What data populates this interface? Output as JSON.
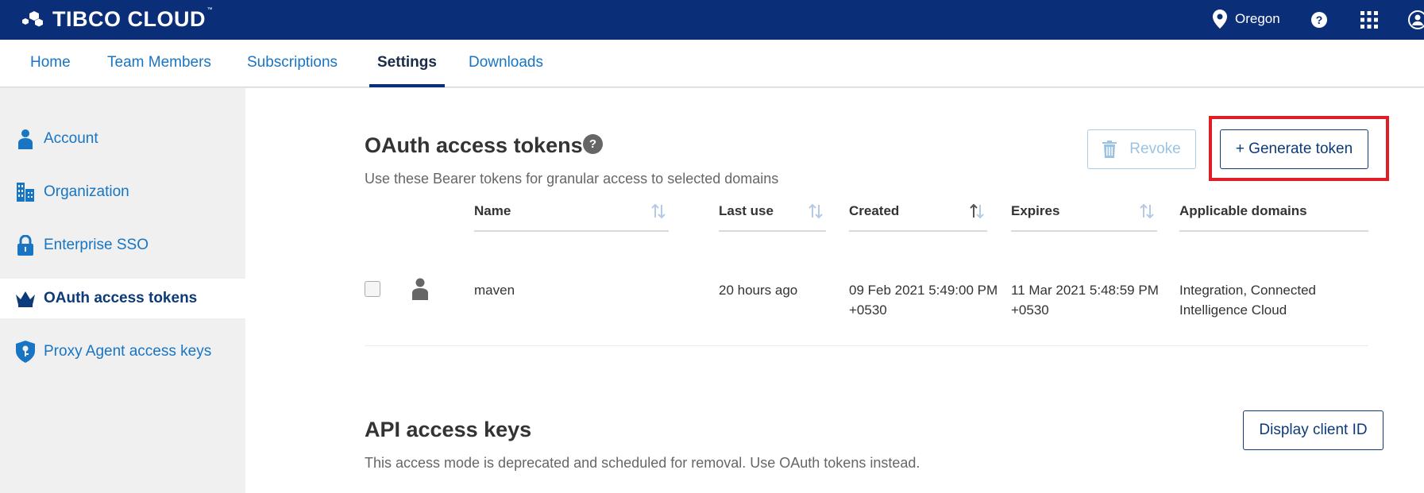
{
  "brand": {
    "name": "TIBCO CLOUD",
    "tm": "™"
  },
  "topbar": {
    "region": "Oregon",
    "help": "?"
  },
  "tabs": [
    {
      "label": "Home"
    },
    {
      "label": "Team Members"
    },
    {
      "label": "Subscriptions"
    },
    {
      "label": "Settings",
      "active": true
    },
    {
      "label": "Downloads"
    }
  ],
  "sidebar": {
    "items": [
      {
        "label": "Account",
        "icon": "user-icon"
      },
      {
        "label": "Organization",
        "icon": "building-icon"
      },
      {
        "label": "Enterprise SSO",
        "icon": "lock-icon"
      },
      {
        "label": "OAuth access tokens",
        "icon": "crown-icon",
        "active": true
      },
      {
        "label": "Proxy Agent access keys",
        "icon": "shield-key-icon"
      }
    ]
  },
  "oauth": {
    "title": "OAuth access tokens",
    "help": "?",
    "subtitle": "Use these Bearer tokens for granular access to selected domains",
    "revoke_label": "Revoke",
    "generate_label": "+ Generate token",
    "columns": {
      "name": "Name",
      "last_use": "Last use",
      "created": "Created",
      "expires": "Expires",
      "domains": "Applicable domains"
    },
    "rows": [
      {
        "name": "maven",
        "last_use": "20 hours ago",
        "created_1": "09 Feb 2021 5:49:00 PM",
        "created_2": "+0530",
        "expires_1": "11 Mar 2021 5:48:59 PM",
        "expires_2": "+0530",
        "domains_1": "Integration, Connected",
        "domains_2": "Intelligence Cloud"
      }
    ]
  },
  "api": {
    "title": "API access keys",
    "subtitle": "This access mode is deprecated and scheduled for removal. Use OAuth tokens instead.",
    "display_label": "Display client ID"
  },
  "colors": {
    "topbar": "#0a2e77",
    "link": "#1875c3",
    "highlight": "#e01e26"
  }
}
